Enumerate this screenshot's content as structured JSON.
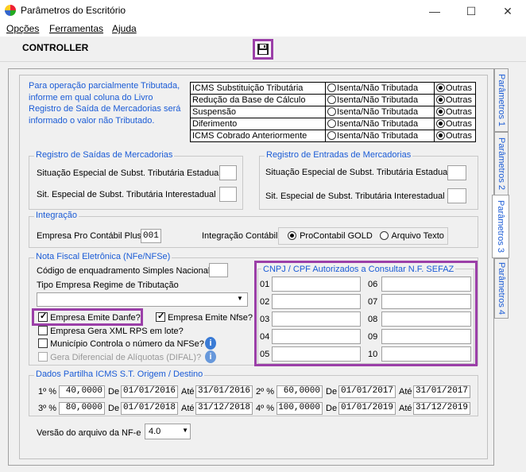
{
  "window": {
    "title": "Parâmetros do Escritório",
    "minimize": "—",
    "maximize": "☐",
    "close": "✕"
  },
  "menu": {
    "opcoes": "Opções",
    "ferramentas": "Ferramentas",
    "ajuda": "Ajuda"
  },
  "toolbar": {
    "brand": "CONTROLLER",
    "save_icon": "floppy-disk-icon"
  },
  "note": "Para operação parcialmente Tributada, informe em qual coluna do Livro Registro de Saída de Mercadorias será informado o valor não Tributado.",
  "st_table": {
    "isenta": "Isenta/Não Tributada",
    "outras": "Outras",
    "rows": [
      "ICMS Substituição Tributária",
      "Redução da Base de Cálculo",
      "Suspensão",
      "Diferimento",
      "ICMS Cobrado Anteriormente"
    ]
  },
  "saidas": {
    "title": "Registro de Saídas de Mercadorias",
    "estadual": "Situação Especial de Subst. Tributária Estadual",
    "interestadual": "Sit. Especial de Subst. Tributária Interestadual"
  },
  "entradas": {
    "title": "Registro de Entradas de Mercadorias",
    "estadual": "Situação Especial de Subst. Tributária Estadual",
    "interestadual": "Sit. Especial de Subst. Tributária Interestadual"
  },
  "integracao": {
    "title": "Integração",
    "empresa_label": "Empresa Pro Contábil Plus",
    "empresa_value": "001",
    "contabil_label": "Integração Contábil",
    "opt1": "ProContabil GOLD",
    "opt2": "Arquivo Texto"
  },
  "nfe": {
    "title": "Nota Fiscal Eletrônica (NFe/NFSe)",
    "simples": "Código de enquadramento Simples Nacional",
    "tipo": "Tipo Empresa Regime de Tributação",
    "danfe": "Empresa Emite Danfe?",
    "nfse": "Empresa Emite Nfse?",
    "xml_rps": "Empresa Gera XML RPS em lote?",
    "municipio": "Município Controla o número da NFSe?",
    "difal": "Gera Diferencial de Alíquotas (DIFAL)?"
  },
  "cnpj": {
    "title": "CNPJ / CPF Autorizados a Consultar N.F. SEFAZ",
    "left": [
      "01",
      "02",
      "03",
      "04",
      "05"
    ],
    "right": [
      "06",
      "07",
      "08",
      "09",
      "10"
    ]
  },
  "partilha": {
    "title": "Dados Partilha ICMS S.T. Origem / Destino",
    "de": "De",
    "ate": "Até",
    "rows": [
      {
        "label": "1º %",
        "pct": "40,0000",
        "de": "01/01/2016",
        "ate": "31/01/2016"
      },
      {
        "label": "2º %",
        "pct": "60,0000",
        "de": "01/01/2017",
        "ate": "31/01/2017"
      },
      {
        "label": "3º %",
        "pct": "80,0000",
        "de": "01/01/2018",
        "ate": "31/12/2018"
      },
      {
        "label": "4º %",
        "pct": "100,0000",
        "de": "01/01/2019",
        "ate": "31/12/2019"
      }
    ]
  },
  "versao": {
    "label": "Versão do arquivo da NF-e",
    "value": "4.0"
  },
  "tabs": [
    "Parâmetros 1",
    "Parâmetros 2",
    "Parâmetros 3",
    "Parâmetros 4"
  ],
  "colors": {
    "highlight": "#9b3fa8",
    "label_blue": "#1a5bd6"
  }
}
